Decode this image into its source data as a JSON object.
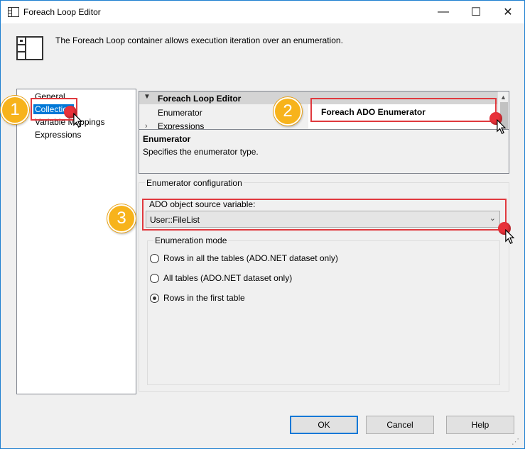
{
  "window": {
    "title": "Foreach Loop Editor",
    "minimize_glyph": "—",
    "maximize_glyph": "☐",
    "close_glyph": "✕"
  },
  "header": {
    "description": "The Foreach Loop container allows execution iteration over an enumeration."
  },
  "nav": {
    "items": [
      {
        "label": "General"
      },
      {
        "label": "Collection"
      },
      {
        "label": "Variable Mappings"
      },
      {
        "label": "Expressions"
      }
    ]
  },
  "property_grid": {
    "category": "Foreach Loop Editor",
    "rows": [
      {
        "label": "Enumerator",
        "value": "Foreach ADO Enumerator"
      },
      {
        "label": "Expressions"
      }
    ]
  },
  "description_panel": {
    "title": "Enumerator",
    "text": "Specifies the enumerator type."
  },
  "enumerator_config": {
    "group_label": "Enumerator configuration",
    "ado_label": "ADO object source variable:",
    "ado_value": "User::FileList",
    "mode_group_label": "Enumeration mode",
    "modes": [
      {
        "label": "Rows in all the tables (ADO.NET dataset only)",
        "selected": false
      },
      {
        "label": "All tables (ADO.NET dataset only)",
        "selected": false
      },
      {
        "label": "Rows in the first table",
        "selected": true
      }
    ]
  },
  "buttons": {
    "ok": "OK",
    "cancel": "Cancel",
    "help": "Help"
  },
  "annotations": {
    "badge_1": "1",
    "badge_2": "2",
    "badge_3": "3",
    "highlight_color": "#e0393e",
    "badge_color": "#f7b31c"
  }
}
